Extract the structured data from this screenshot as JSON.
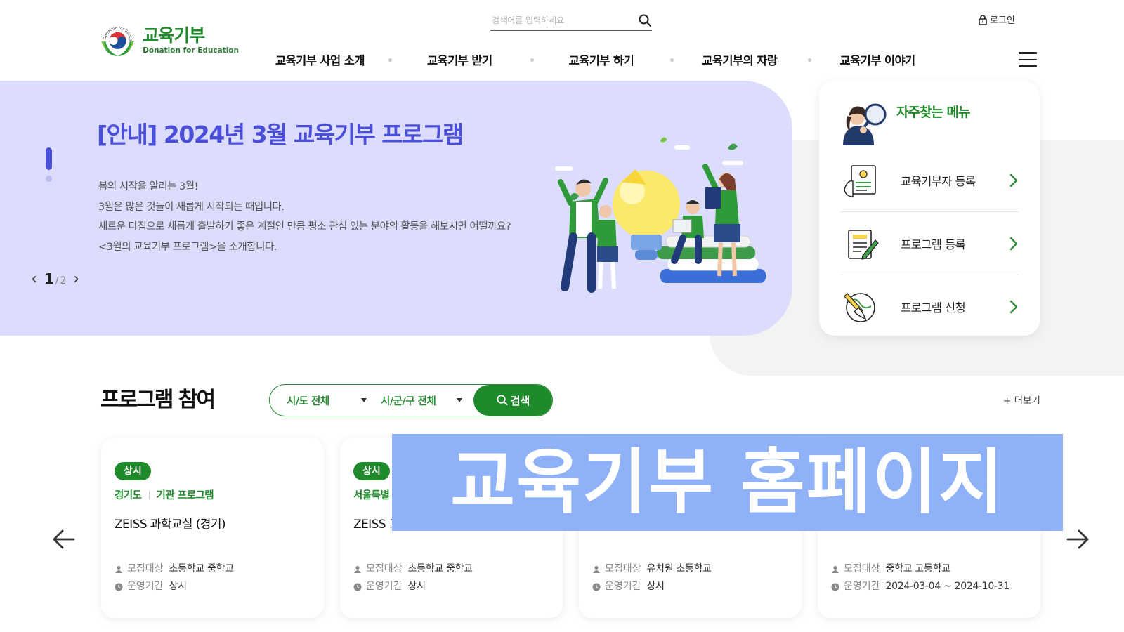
{
  "header": {
    "logo_title": "교육기부",
    "logo_subtitle": "Donation for Education",
    "logo_ring_text": "Donation for Education",
    "search_placeholder": "검색어를 입력하세요",
    "login_label": "로그인",
    "nav": [
      {
        "label": "교육기부 사업 소개"
      },
      {
        "label": "교육기부 받기"
      },
      {
        "label": "교육기부 하기"
      },
      {
        "label": "교육기부의 자랑"
      },
      {
        "label": "교육기부 이야기"
      }
    ]
  },
  "hero": {
    "title": "[안내] 2024년 3월 교육기부 프로그램",
    "lines": [
      "봄의 시작을 알리는 3월!",
      "3월은 많은 것들이 새롭게 시작되는 때입니다.",
      "새로운 다짐으로 새롭게 출발하기 좋은 계절인 만큼 평소 관심 있는 분야의 활동을 해보시면 어떨까요?",
      "<3월의 교육기부 프로그램>을 소개합니다."
    ],
    "pager": {
      "current": "1",
      "separator": "/",
      "total": "2"
    },
    "accent_color": "#4b4fd8",
    "background_color": "#dcdcfd"
  },
  "quick_menu": {
    "title": "자주찾는 메뉴",
    "items": [
      {
        "label": "교육기부자 등록",
        "icon": "donor-registration-icon"
      },
      {
        "label": "프로그램 등록",
        "icon": "program-registration-icon"
      },
      {
        "label": "프로그램 신청",
        "icon": "program-application-icon"
      }
    ]
  },
  "programs": {
    "title": "프로그램 참여",
    "filter_region": "시/도 전체",
    "filter_district": "시/군/구 전체",
    "search_label": "검색",
    "more_label": "+ 더보기",
    "meta_target_label": "모집대상",
    "meta_period_label": "운영기간",
    "brand_color": "#1f8a2b",
    "cards": [
      {
        "badge": "상시",
        "region": "경기도",
        "org": "기관 프로그램",
        "title": "ZEISS 과학교실 (경기)",
        "target": "초등학교 중학교",
        "period": "상시"
      },
      {
        "badge": "상시",
        "region": "서울특별",
        "org": "",
        "title": "ZEISS 고",
        "target": "초등학교 중학교",
        "period": "상시"
      },
      {
        "badge": "",
        "region": "",
        "org": "",
        "title": "",
        "target": "유치원 초등학교",
        "period": "상시"
      },
      {
        "badge": "",
        "region": "",
        "org": "",
        "title": "",
        "target": "중학교 고등학교",
        "period": "2024-03-04 ~ 2024-10-31"
      }
    ]
  },
  "overlay": {
    "caption": "교육기부 홈페이지",
    "background_color": "#8fb1f7"
  }
}
